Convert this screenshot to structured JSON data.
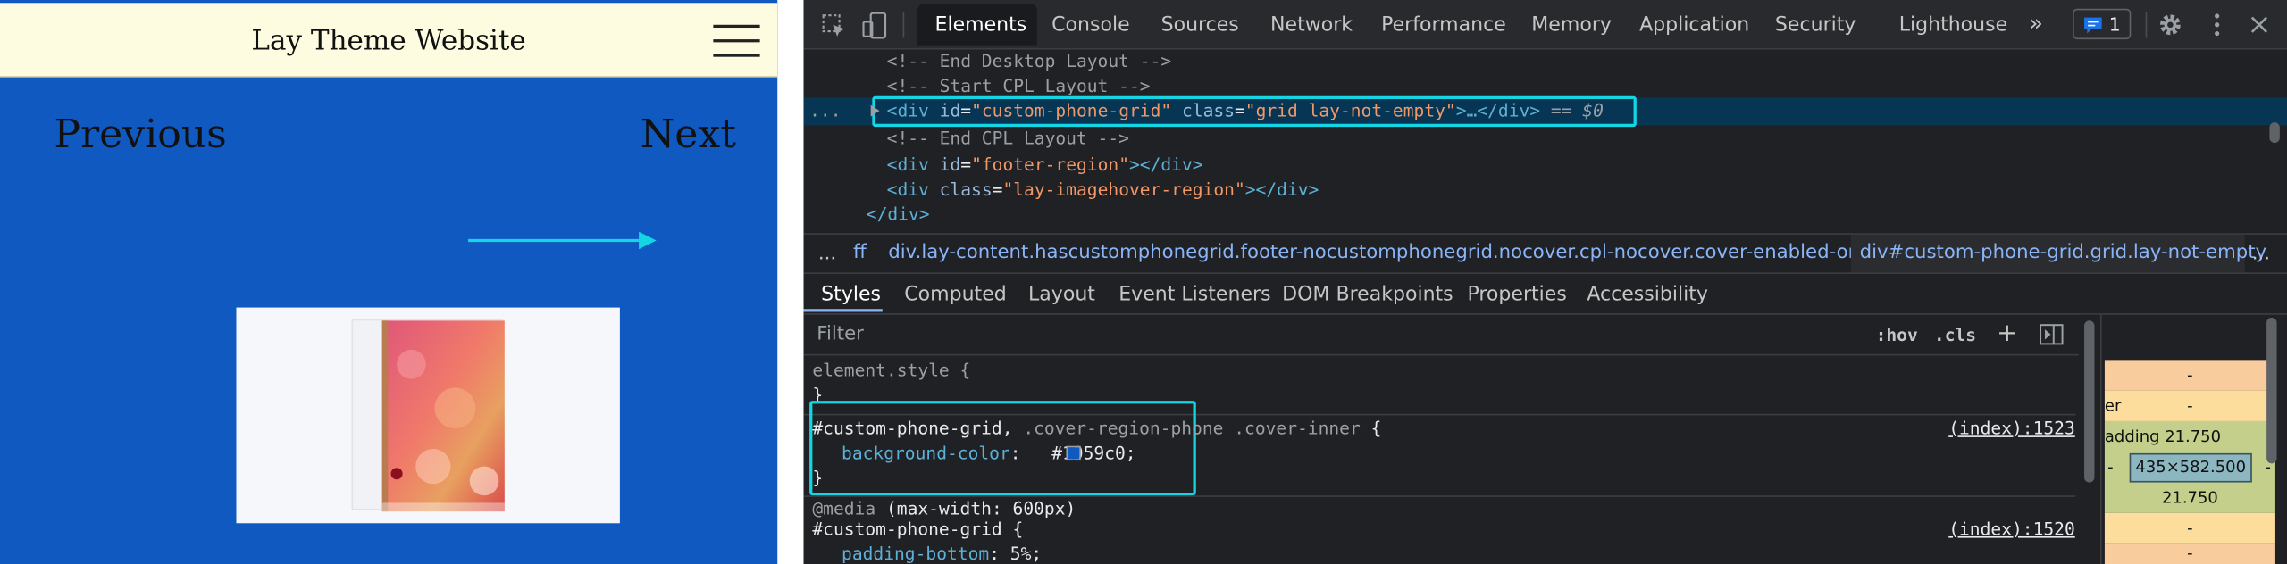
{
  "preview": {
    "site_title": "Lay Theme Website",
    "prev_label": "Previous",
    "next_label": "Next",
    "bg_color": "#1059c0",
    "header_bg": "#fdfce0"
  },
  "devtools": {
    "tabs": [
      "Elements",
      "Console",
      "Sources",
      "Network",
      "Performance",
      "Memory",
      "Application",
      "Security",
      "Lighthouse"
    ],
    "issues_count": "1",
    "dom": {
      "l1": "<!-- End Desktop Layout -->",
      "l2": "<!-- Start CPL Layout -->",
      "l3_open": "<div",
      "l3_id_attr": "id",
      "l3_id_val": "\"custom-phone-grid\"",
      "l3_class_attr": "class",
      "l3_class_val": "\"grid lay-not-empty\"",
      "l3_close": ">…</div>",
      "l3_eq": "== $0",
      "l4": "<!-- End CPL Layout -->",
      "l5_open": "<div",
      "l5_attr": "id",
      "l5_val": "\"footer-region\"",
      "l5_close": "></div>",
      "l6_open": "<div",
      "l6_attr": "class",
      "l6_val": "\"lay-imagehover-region\"",
      "l6_close": "></div>",
      "l7": "</div>",
      "dots": "..."
    },
    "breadcrumb": {
      "ellipsis": "...",
      "ff": "ff",
      "item1": "div.lay-content.hascustomphonegrid.footer-nocustomphonegrid.nocover.cpl-nocover.cover-enabled-on-phone",
      "item2": "div#custom-phone-grid.grid.lay-not-empty",
      "more": "..."
    },
    "subtabs": [
      "Styles",
      "Computed",
      "Layout",
      "Event Listeners",
      "DOM Breakpoints",
      "Properties",
      "Accessibility"
    ],
    "filter_placeholder": "Filter",
    "hov": ":hov",
    "cls": ".cls",
    "plus": "+",
    "styles": {
      "r1_selector": "element.style {",
      "r1_close": "}",
      "r2_sel_a": "#custom-phone-grid,",
      "r2_sel_b": ".cover-region-phone .cover-inner",
      "r2_brace": "{",
      "r2_source": "(index):1523",
      "r2_prop": "background-color",
      "r2_val": "#1059c0",
      "r2_close": "}",
      "swatch_color": "#1059c0",
      "r3_media": "@media",
      "r3_query": "(max-width: 600px)",
      "r3_sel": "#custom-phone-grid {",
      "r3_source": "(index):1520",
      "r3_prop": "padding-bottom",
      "r3_val": "5%;"
    },
    "box_model": {
      "dash1": "-",
      "border_label": "er",
      "dash2": "-",
      "padding_label": "adding 21.750",
      "content_size": "435×582.500",
      "left_dash": "-",
      "right_dash": "-",
      "padding_bottom": "21.750",
      "dash3": "-",
      "dash4": "-"
    },
    "accent_color": "#15d5e4"
  }
}
